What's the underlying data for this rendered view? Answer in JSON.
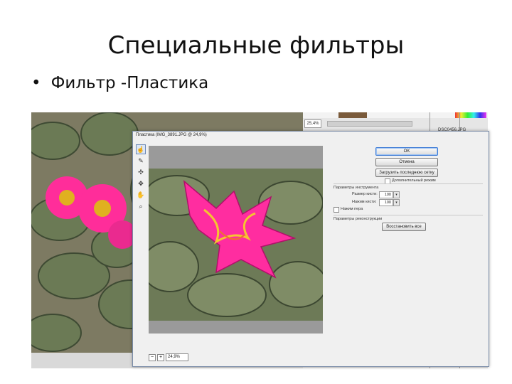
{
  "slide": {
    "title": "Специальные фильтры",
    "bullet": "Фильтр -Пластика",
    "bullet_marker": "•"
  },
  "background_app": {
    "zoom": "25,4%",
    "layer_name": "DSC0456.JPG"
  },
  "dialog": {
    "title": "Пластика (IMG_3891.JPG @ 24,9%)",
    "tools": [
      "warp-icon",
      "reconstruct-icon",
      "pucker-icon",
      "bloat-icon",
      "hand-icon",
      "zoom-icon"
    ],
    "buttons": {
      "ok": "OK",
      "cancel": "Отмена",
      "load_mesh": "Загрузить последнюю сетку",
      "restore_all": "Восстановить все"
    },
    "advanced_mode_label": "Дополнительный режим",
    "tool_options_heading": "Параметры инструмента",
    "brush_size_label": "Размер кисти:",
    "brush_size_value": "100",
    "brush_pressure_label": "Нажим кисти:",
    "brush_pressure_value": "100",
    "stylus_pressure_label": "Нажим пера",
    "reconstruct_heading": "Параметры реконструкции",
    "zoom_value": "24,9%",
    "zoom_minus": "−",
    "zoom_plus": "+"
  },
  "colors": {
    "flower": "#ff2d9a",
    "cactus": "#5f6f4a",
    "accent_button": "#3d7bd6"
  }
}
